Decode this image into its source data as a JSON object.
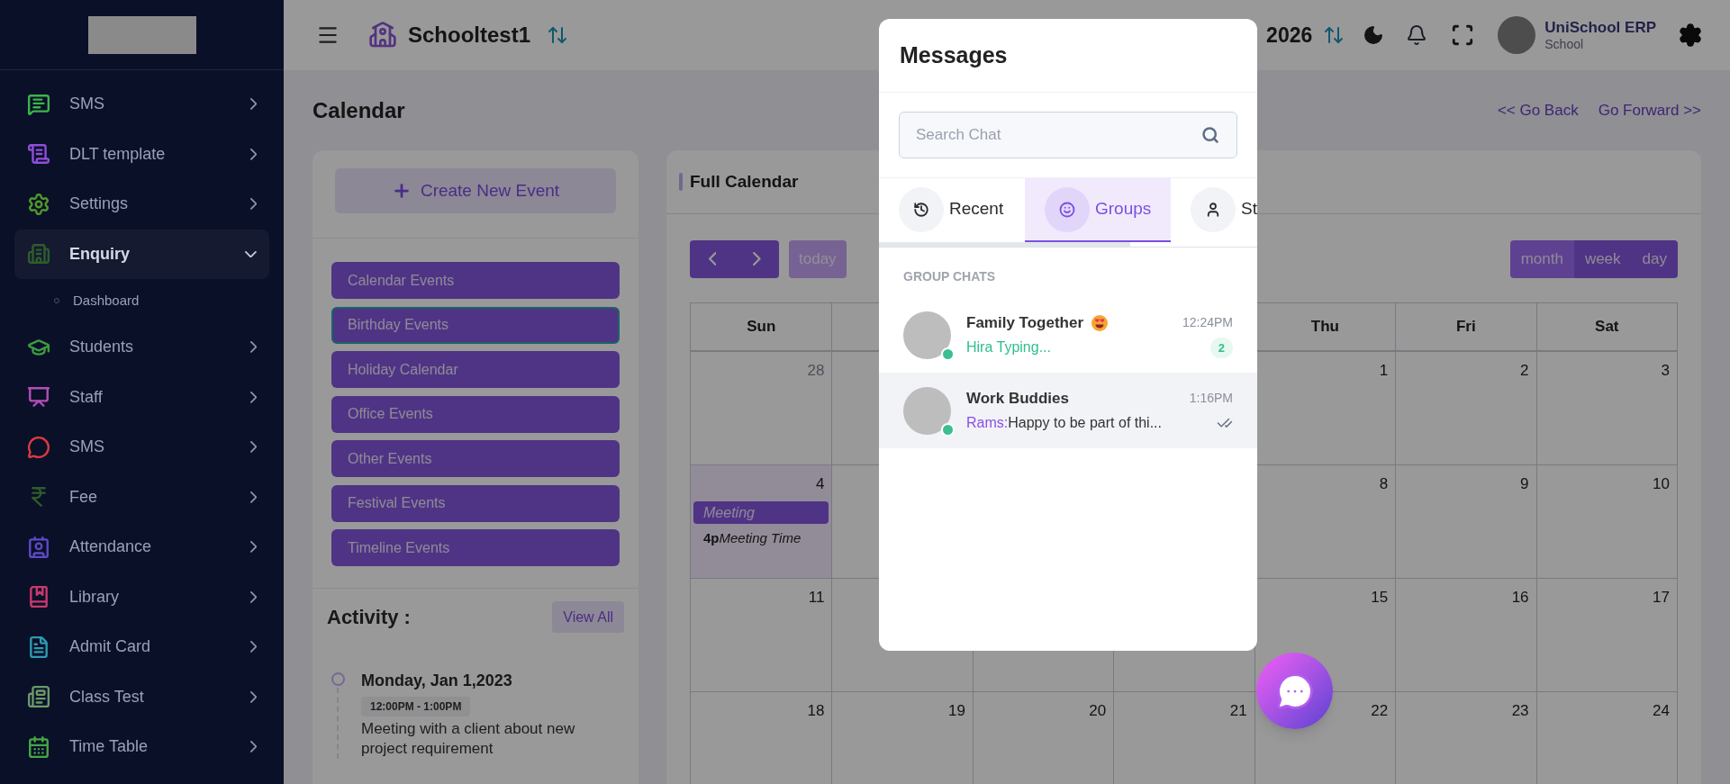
{
  "sidebar": {
    "items": [
      {
        "label": "SMS",
        "expanded": false
      },
      {
        "label": "DLT template",
        "expanded": false
      },
      {
        "label": "Settings",
        "expanded": false
      },
      {
        "label": "Enquiry",
        "expanded": true,
        "children": [
          {
            "label": "Dashboard"
          }
        ]
      },
      {
        "label": "Students",
        "expanded": false
      },
      {
        "label": "Staff",
        "expanded": false
      },
      {
        "label": "SMS",
        "expanded": false
      },
      {
        "label": "Fee",
        "expanded": false
      },
      {
        "label": "Attendance",
        "expanded": false
      },
      {
        "label": "Library",
        "expanded": false
      },
      {
        "label": "Admit Card",
        "expanded": false
      },
      {
        "label": "Class Test",
        "expanded": false
      },
      {
        "label": "Time Table",
        "expanded": false
      }
    ]
  },
  "header": {
    "school": "Schooltest1",
    "year": "2026",
    "user": {
      "name": "UniSchool ERP",
      "role": "School"
    }
  },
  "page": {
    "title": "Calendar",
    "links": [
      "<< Go Back",
      "Go Forward >>"
    ]
  },
  "events_panel": {
    "create_button": "Create New Event",
    "categories": [
      {
        "label": "Calendar Events",
        "selected": false
      },
      {
        "label": "Birthday Events",
        "selected": true
      },
      {
        "label": "Holiday Calendar",
        "selected": false
      },
      {
        "label": "Office Events",
        "selected": false
      },
      {
        "label": "Other Events",
        "selected": false
      },
      {
        "label": "Festival Events",
        "selected": false
      },
      {
        "label": "Timeline Events",
        "selected": false
      }
    ],
    "activity": {
      "title": "Activity :",
      "view_all": "View All",
      "items": [
        {
          "date": "Monday, Jan 1,2023",
          "time": "12:00PM - 1:00PM",
          "text": "Meeting with a client about new project requirement"
        }
      ]
    }
  },
  "calendar": {
    "title": "Full Calendar",
    "today_button": "today",
    "views": [
      {
        "label": "month",
        "selected": true
      },
      {
        "label": "week",
        "selected": false
      },
      {
        "label": "day",
        "selected": false
      }
    ],
    "weekdays": [
      "Sun",
      "Thu",
      "Fri",
      "Sat"
    ],
    "weeks": [
      [
        {
          "date": "28",
          "other_month": true,
          "today": false
        },
        {
          "date": "1",
          "other_month": false,
          "today": false
        },
        {
          "date": "2",
          "other_month": false,
          "today": false
        },
        {
          "date": "3",
          "other_month": false,
          "today": false
        }
      ],
      [
        {
          "date": "4",
          "other_month": false,
          "today": true,
          "events": [
            {
              "kind": "block",
              "title": "Meeting"
            },
            {
              "kind": "timed",
              "time": "4p",
              "title": "Meeting Time"
            }
          ]
        },
        {
          "date": "8",
          "other_month": false,
          "today": false
        },
        {
          "date": "9",
          "other_month": false,
          "today": false
        },
        {
          "date": "10",
          "other_month": false,
          "today": false
        }
      ],
      [
        {
          "date": "11",
          "other_month": false,
          "today": false
        },
        {
          "date": "15",
          "other_month": false,
          "today": false
        },
        {
          "date": "16",
          "other_month": false,
          "today": false
        },
        {
          "date": "17",
          "other_month": false,
          "today": false
        }
      ],
      [
        {
          "date": "18",
          "other_month": false,
          "today": false
        },
        {
          "date": "19",
          "other_month": false,
          "today": false
        },
        {
          "date": "20",
          "other_month": false,
          "today": false
        },
        {
          "date": "21",
          "other_month": false,
          "today": false
        },
        {
          "date": "22",
          "other_month": false,
          "today": false
        },
        {
          "date": "23",
          "other_month": false,
          "today": false
        },
        {
          "date": "24",
          "other_month": false,
          "today": false
        }
      ]
    ]
  },
  "messages": {
    "title": "Messages",
    "search": {
      "placeholder": "Search Chat"
    },
    "tabs": [
      {
        "label": "Recent",
        "selected": false
      },
      {
        "label": "Groups",
        "selected": true
      },
      {
        "label": "St",
        "selected": false
      }
    ],
    "section": "GROUP CHATS",
    "chats": [
      {
        "name": "Family Together",
        "emoji": true,
        "time": "12:24PM",
        "kind": "typing",
        "preview": "Hira Typing...",
        "unread": "2",
        "online": true,
        "highlighted": false
      },
      {
        "name": "Work Buddies",
        "emoji": false,
        "time": "1:16PM",
        "kind": "message",
        "sender": "Rams:",
        "preview": "Happy to be part of thi...",
        "read": true,
        "online": true,
        "highlighted": true
      }
    ]
  }
}
